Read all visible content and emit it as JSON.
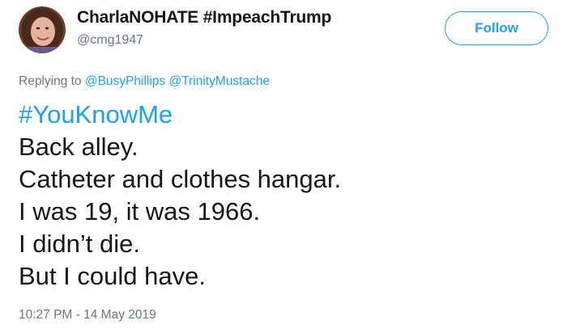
{
  "user": {
    "display_name": "CharlaNOHATE #ImpeachTrump",
    "handle": "@cmg1947",
    "avatar_icon": "profile-photo"
  },
  "follow_button": {
    "label": "Follow"
  },
  "reply": {
    "prefix": "Replying to",
    "mentions": [
      "@BusyPhillips",
      "@TrinityMustache"
    ]
  },
  "tweet": {
    "hashtag": "#YouKnowMe",
    "lines": [
      "Back alley.",
      "Catheter and clothes hangar.",
      "I was 19, it was 1966.",
      "I didn’t die.",
      "But I could have."
    ]
  },
  "timestamp": "10:27 PM - 14 May 2019",
  "colors": {
    "accent": "#1da1f2",
    "text": "#14171a",
    "muted": "#657786"
  }
}
